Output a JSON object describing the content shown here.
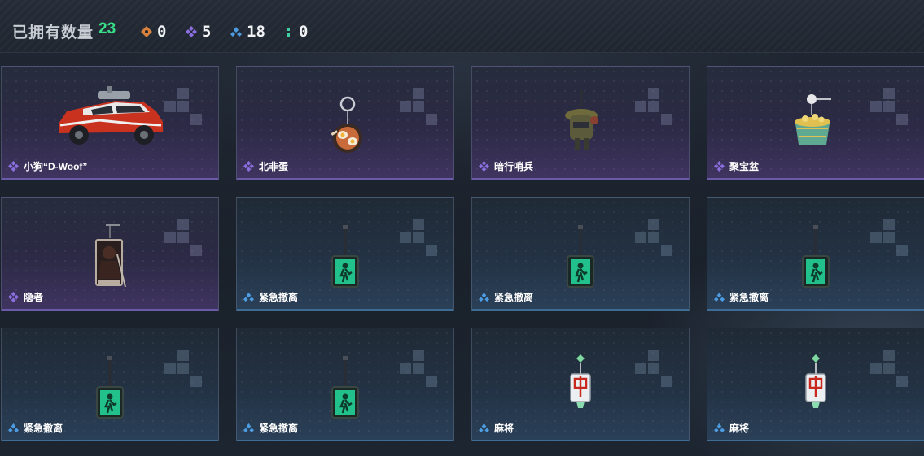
{
  "header": {
    "owned_label": "已拥有数量",
    "owned_count": "23",
    "stats": [
      {
        "icon": "orange-diamond-icon",
        "color": "#d9823e",
        "value": "0"
      },
      {
        "icon": "purple-diamond-icon",
        "color": "#8b6fe0",
        "value": "5"
      },
      {
        "icon": "blue-diamond-icon",
        "color": "#4d9be0",
        "value": "18"
      },
      {
        "icon": "green-dots-icon",
        "color": "#3fcfa0",
        "value": "0"
      }
    ]
  },
  "colors": {
    "purple_rarity": "#8b6fe0",
    "blue_rarity": "#4d9be0",
    "owned_count": "#38e08a"
  },
  "items": [
    {
      "name": "小狗“D-Woof”",
      "rarity": "purple",
      "art": "car-icon"
    },
    {
      "name": "北非蛋",
      "rarity": "purple",
      "art": "pan-charm-icon"
    },
    {
      "name": "暗行哨兵",
      "rarity": "purple",
      "art": "soldier-charm-icon"
    },
    {
      "name": "聚宝盆",
      "rarity": "purple",
      "art": "treasure-bowl-icon"
    },
    {
      "name": "隐者",
      "rarity": "purple",
      "art": "hermit-card-icon"
    },
    {
      "name": "紧急撤离",
      "rarity": "blue",
      "art": "exit-sign-icon"
    },
    {
      "name": "紧急撤离",
      "rarity": "blue",
      "art": "exit-sign-icon"
    },
    {
      "name": "紧急撤离",
      "rarity": "blue",
      "art": "exit-sign-icon"
    },
    {
      "name": "紧急撤离",
      "rarity": "blue",
      "art": "exit-sign-icon"
    },
    {
      "name": "紧急撤离",
      "rarity": "blue",
      "art": "exit-sign-icon"
    },
    {
      "name": "麻将",
      "rarity": "blue",
      "art": "mahjong-tile-icon"
    },
    {
      "name": "麻将",
      "rarity": "blue",
      "art": "mahjong-tile-icon"
    }
  ]
}
